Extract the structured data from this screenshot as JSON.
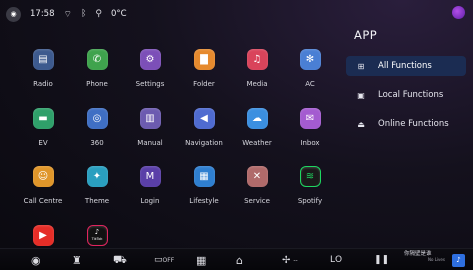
{
  "status_bar": {
    "time": "17:58",
    "temperature": "0°C",
    "icons": [
      "voice-logo-icon",
      "wifi-icon",
      "bluetooth-icon",
      "signal-icon"
    ]
  },
  "apps": [
    {
      "label": "Radio",
      "icon": "radio-icon",
      "color": "#3d5a8e",
      "glyph": "▤"
    },
    {
      "label": "Phone",
      "icon": "phone-icon",
      "color": "#3fa34d",
      "glyph": "✆"
    },
    {
      "label": "Settings",
      "icon": "settings-icon",
      "color": "#7c4fb8",
      "glyph": "⚙"
    },
    {
      "label": "Folder",
      "icon": "folder-icon",
      "color": "#e68a2e",
      "glyph": "▇"
    },
    {
      "label": "Media",
      "icon": "media-icon",
      "color": "#d9445b",
      "glyph": "♫"
    },
    {
      "label": "AC",
      "icon": "ac-icon",
      "color": "#4a7fd4",
      "glyph": "✻"
    },
    {
      "label": "EV",
      "icon": "ev-icon",
      "color": "#2fa06a",
      "glyph": "▬"
    },
    {
      "label": "360",
      "icon": "360-camera-icon",
      "color": "#3f6fc4",
      "glyph": "◎"
    },
    {
      "label": "Manual",
      "icon": "manual-icon",
      "color": "#6c5bb0",
      "glyph": "▥"
    },
    {
      "label": "Navigation",
      "icon": "navigation-icon",
      "color": "#4f6bd0",
      "glyph": "◀"
    },
    {
      "label": "Weather",
      "icon": "weather-icon",
      "color": "#3b8fe0",
      "glyph": "☁"
    },
    {
      "label": "Inbox",
      "icon": "inbox-icon",
      "color": "#a45bd0",
      "glyph": "✉"
    },
    {
      "label": "Call Centre",
      "icon": "call-centre-icon",
      "color": "#e0962a",
      "glyph": "☺"
    },
    {
      "label": "Theme",
      "icon": "theme-icon",
      "color": "#2a9fbf",
      "glyph": "✦"
    },
    {
      "label": "Login",
      "icon": "login-icon",
      "color": "#5a3fa8",
      "glyph": "M"
    },
    {
      "label": "Lifestyle",
      "icon": "lifestyle-icon",
      "color": "#2f7fd0",
      "glyph": "▦"
    },
    {
      "label": "Service",
      "icon": "service-icon",
      "color": "#b06a6a",
      "glyph": "✕"
    },
    {
      "label": "Spotify",
      "icon": "spotify-icon",
      "color": "#1a1a1a",
      "glyph": "≋"
    },
    {
      "label": "",
      "icon": "youtube-icon",
      "color": "#e52d27",
      "glyph": "▶"
    },
    {
      "label": "",
      "icon": "tiktok-icon",
      "color": "#111111",
      "glyph": "♪",
      "inner_text": "TikTok"
    }
  ],
  "panel": {
    "title": "APP",
    "items": [
      {
        "label": "All Functions",
        "icon": "grid-icon",
        "active": true
      },
      {
        "label": "Local Functions",
        "icon": "local-icon",
        "active": false
      },
      {
        "label": "Online Functions",
        "icon": "cloud-download-icon",
        "active": false
      }
    ]
  },
  "dock": {
    "seat_label": "OFF",
    "fan_value": "--",
    "temp_label": "LO",
    "media_title": "你隔壁是谁",
    "media_subtitle": "No Lives"
  },
  "colors": {
    "background": "#0a090f",
    "active_item": "#1b2c52",
    "accent_purple": "#8a3fd8"
  }
}
